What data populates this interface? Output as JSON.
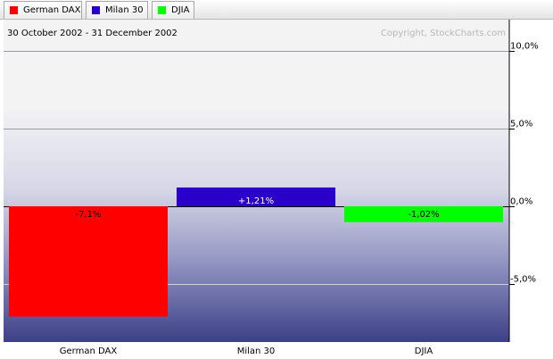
{
  "tabs": [
    {
      "label": "German DAX",
      "color": "#ff0000"
    },
    {
      "label": "Milan 30",
      "color": "#2a00c8"
    },
    {
      "label": "DJIA",
      "color": "#00ff00"
    }
  ],
  "header": {
    "date_range": "30 October 2002 - 31 December 2002",
    "copyright": "Copyright, StockCharts.com"
  },
  "chart_data": {
    "type": "bar",
    "categories": [
      "German DAX",
      "Milan 30",
      "DJIA"
    ],
    "values": [
      -7.1,
      1.21,
      -1.02
    ],
    "value_labels": [
      "-7,1%",
      "+1,21%",
      "-1,02%"
    ],
    "colors": [
      "#ff0000",
      "#2a00c8",
      "#00ff00"
    ],
    "title": "",
    "xlabel": "",
    "ylabel": "",
    "ylim": [
      -8.8,
      10.5
    ],
    "yticks": [
      10,
      5,
      0,
      -5
    ],
    "ytick_labels": [
      "10,0%",
      "5,0%",
      "0,0%",
      "-5,0%"
    ],
    "grid": true
  }
}
